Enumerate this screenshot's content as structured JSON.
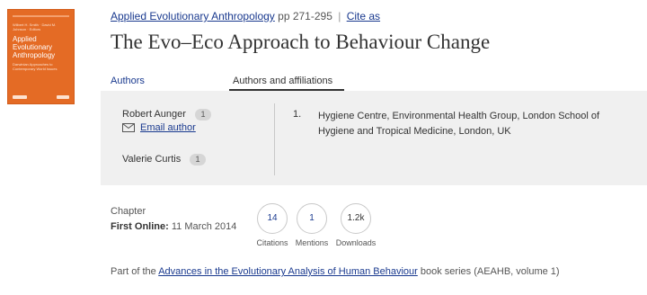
{
  "cover": {
    "editors": "Wilbert H. Smith · David M. Johnson · Editors",
    "title": "Applied Evolutionary Anthropology",
    "subtitle": "Darwinian Approaches to Contemporary World Issues",
    "accent_color": "#e46b25"
  },
  "header": {
    "book_link": "Applied Evolutionary Anthropology",
    "pages": "pp 271-295",
    "separator": "|",
    "cite_link": "Cite as"
  },
  "chapter_title": "The Evo–Eco Approach to Behaviour Change",
  "tabs": [
    {
      "label": "Authors"
    },
    {
      "label": "Authors and affiliations"
    }
  ],
  "authors": [
    {
      "name": "Robert Aunger",
      "affil_ref": "1",
      "email_label": "Email author"
    },
    {
      "name": "Valerie Curtis",
      "affil_ref": "1"
    }
  ],
  "affiliations": [
    {
      "num": "1.",
      "text": "Hygiene Centre, Environmental Health Group, London School of Hygiene and Tropical Medicine, London, UK"
    }
  ],
  "chapter_info": {
    "type": "Chapter",
    "first_online_label": "First Online:",
    "first_online_date": "11 March 2014"
  },
  "metrics": [
    {
      "value": "14",
      "label": "Citations"
    },
    {
      "value": "1",
      "label": "Mentions"
    },
    {
      "value": "1.2k",
      "label": "Downloads"
    }
  ],
  "series": {
    "prefix": "Part of the",
    "link": "Advances in the Evolutionary Analysis of Human Behaviour",
    "suffix": "book series (AEAHB, volume 1)"
  },
  "colors": {
    "link": "#1a3a8f",
    "panel_bg": "#f0f0f0"
  }
}
